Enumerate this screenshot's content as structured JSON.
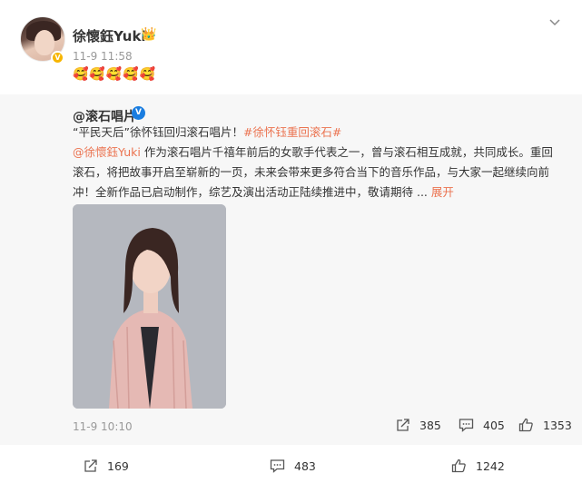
{
  "post": {
    "author_name": "徐懷鈺Yuki",
    "author_badge_icon": "crown-emoji",
    "verified_mark": "V",
    "timestamp": "11-9 11:58",
    "emoji_text": "🥰🥰🥰🥰🥰",
    "menu_icon": "chevron-down-icon"
  },
  "repost": {
    "author_name": "@滚石唱片",
    "verified_mark": "V",
    "text_lead": "“平民天后”徐怀钰回归滚石唱片！",
    "hashtag": "#徐怀钰重回滚石#",
    "mention": "@徐懷鈺Yuki",
    "text_body": " 作为滚石唱片千禧年前后的女歌手代表之一，曾与滚石相互成就，共同成长。重回滚石，将把故事开启至崭新的一页，未来会带来更多符合当下的音乐作品，与大家一起继续向前冲！全新作品已启动制作，综艺及演出活动正陆续推进中，敬请期待 ...",
    "expand_label": " 展开",
    "timestamp": "11-9 10:10",
    "shares": "385",
    "comments": "405",
    "likes": "1353"
  },
  "footer": {
    "shares": "169",
    "comments": "483",
    "likes": "1242"
  },
  "colors": {
    "accent": "#eb7350",
    "verified_blue": "#1a7de0",
    "verified_gold": "#f7b500"
  }
}
